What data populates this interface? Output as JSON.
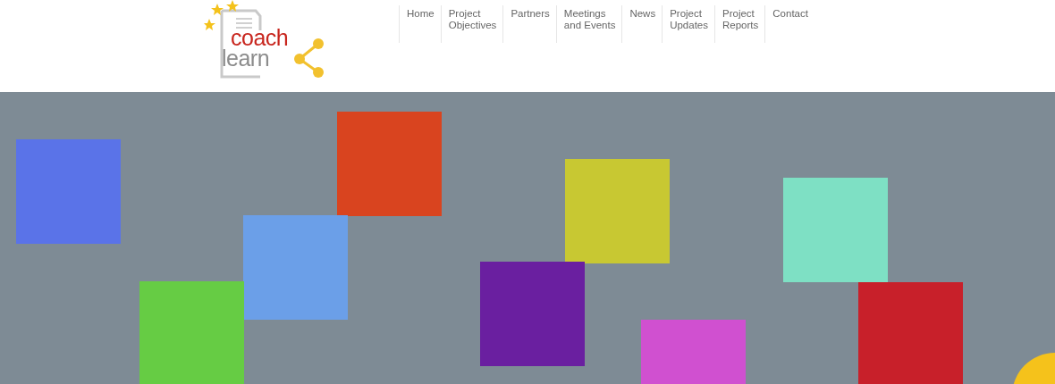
{
  "logo": {
    "lines": [
      "coach",
      "learn"
    ]
  },
  "nav": [
    {
      "label": "Home"
    },
    {
      "label": "Project Objectives"
    },
    {
      "label": "Partners"
    },
    {
      "label": "Meetings and Events"
    },
    {
      "label": "News"
    },
    {
      "label": "Project Updates"
    },
    {
      "label": "Project Reports"
    },
    {
      "label": "Contact"
    }
  ]
}
